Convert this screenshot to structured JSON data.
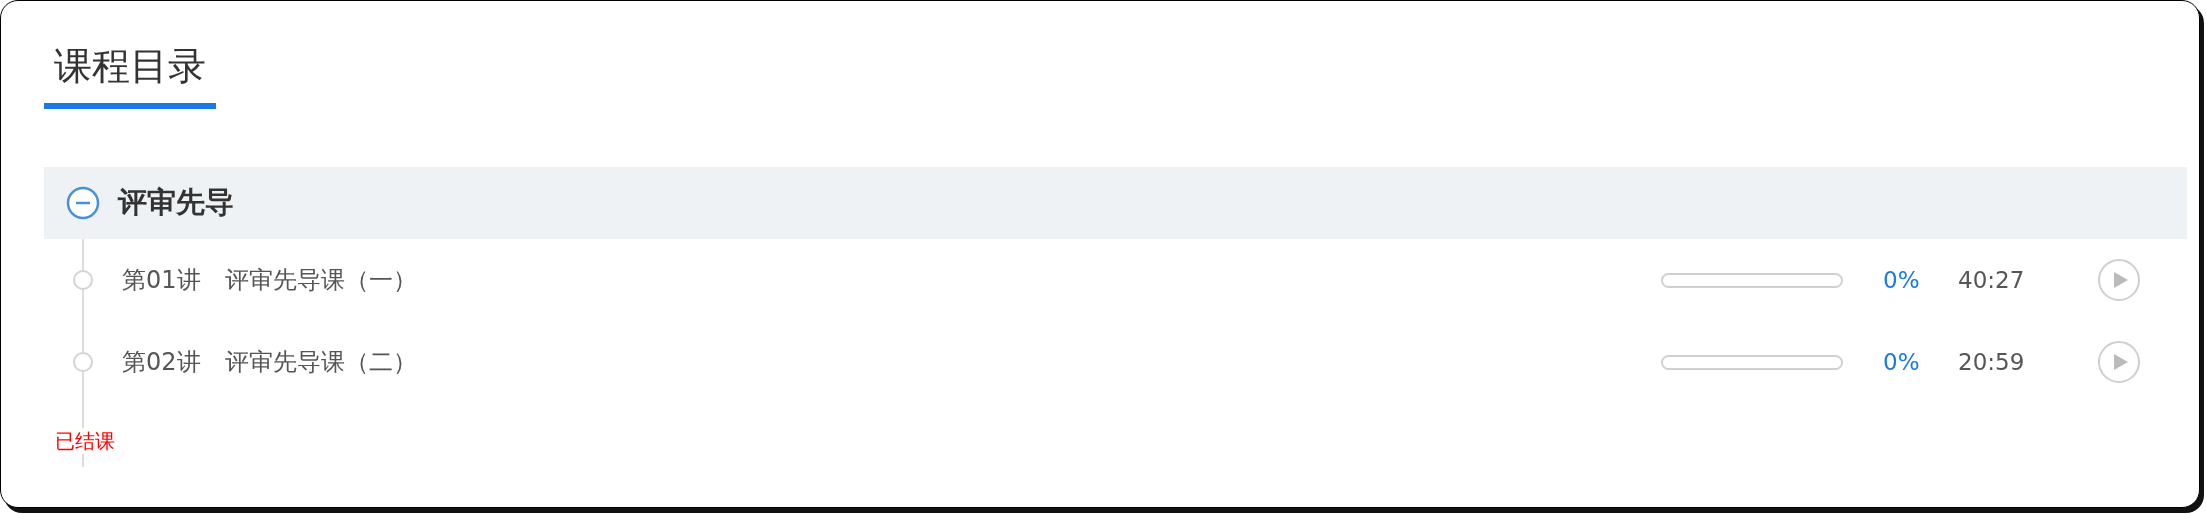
{
  "title": "课程目录",
  "chapter": {
    "name": "评审先导",
    "expanded": true,
    "lectures": [
      {
        "number": "第01讲",
        "title": "评审先导课（一）",
        "level": 0,
        "percent": "0%",
        "duration": "40:27"
      },
      {
        "number": "第02讲",
        "title": "评审先导课（二）",
        "level": 0,
        "percent": "0%",
        "duration": "20:59"
      }
    ]
  },
  "status": "已结课"
}
